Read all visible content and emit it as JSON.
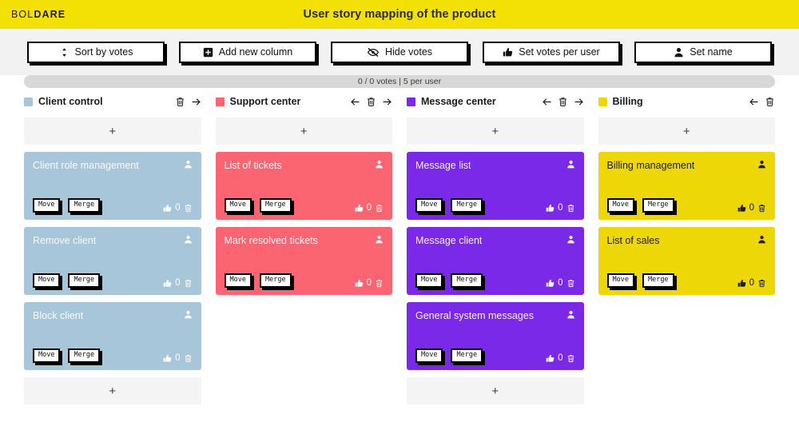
{
  "header": {
    "logo_prefix": "BOL",
    "logo_suffix": "DARE",
    "title": "User story mapping of the product",
    "bg_color": "#f3e004"
  },
  "toolbar": {
    "buttons": [
      {
        "label": "Sort by votes",
        "icon": "sort-icon"
      },
      {
        "label": "Add new column",
        "icon": "plus-square-icon"
      },
      {
        "label": "Hide votes",
        "icon": "eye-slash-icon"
      },
      {
        "label": "Set votes per user",
        "icon": "thumbs-up-icon"
      },
      {
        "label": "Set name",
        "icon": "person-icon"
      }
    ]
  },
  "board": {
    "vote_status": "0 / 0 votes | 5 per user",
    "add_card_label": "+",
    "move_label": "Move",
    "merge_label": "Merge",
    "columns": [
      {
        "name": "Client control",
        "color": "#a7c6da",
        "text_mode": "light-text",
        "move_left": false,
        "move_right": true,
        "cards": [
          {
            "title": "Client role management",
            "votes": "0"
          },
          {
            "title": "Remove client",
            "votes": "0"
          },
          {
            "title": "Block client",
            "votes": "0"
          }
        ],
        "trailing_add": true
      },
      {
        "name": "Support center",
        "color": "#fb6571",
        "text_mode": "light-text",
        "move_left": true,
        "move_right": true,
        "cards": [
          {
            "title": "List of tickets",
            "votes": "0"
          },
          {
            "title": "Mark resolved tickets",
            "votes": "0"
          }
        ],
        "trailing_add": false
      },
      {
        "name": "Message center",
        "color": "#7b29e8",
        "text_mode": "light-text",
        "move_left": true,
        "move_right": true,
        "cards": [
          {
            "title": "Message list",
            "votes": "0"
          },
          {
            "title": "Message client",
            "votes": "0"
          },
          {
            "title": "General system messages",
            "votes": "0"
          }
        ],
        "trailing_add": true
      },
      {
        "name": "Billing",
        "color": "#eed707",
        "text_mode": "dark-text",
        "move_left": true,
        "move_right": false,
        "cards": [
          {
            "title": "Billing management",
            "votes": "0"
          },
          {
            "title": "List of sales",
            "votes": "0"
          }
        ],
        "trailing_add": false
      }
    ]
  }
}
